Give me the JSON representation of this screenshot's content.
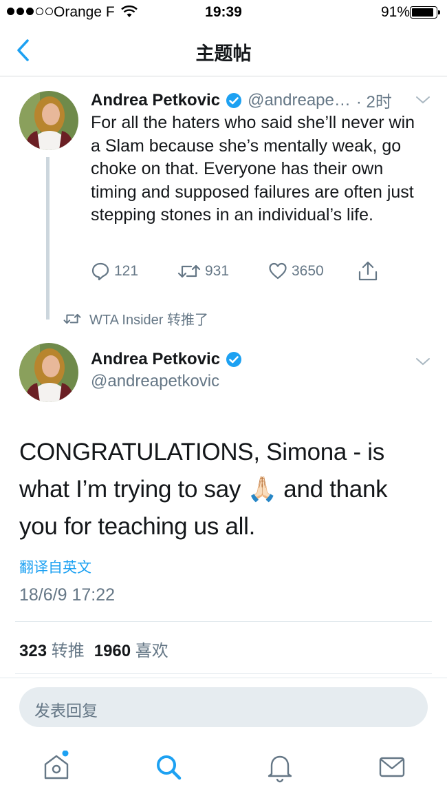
{
  "status_bar": {
    "carrier": "Orange F",
    "time": "19:39",
    "battery": "91%",
    "battery_level": 0.91
  },
  "nav": {
    "title": "主题帖",
    "back_icon": "chevron-left-icon"
  },
  "parent_tweet": {
    "name": "Andrea Petkovic",
    "handle": "@andreape…",
    "time": "· 2时",
    "text": "For all the haters who said she’ll never win a Slam because she’s mentally weak, go choke on that. Everyone has their own timing and supposed failures are often just stepping stones in an individual’s life.",
    "replies": "121",
    "retweets": "931",
    "likes": "3650"
  },
  "retweeted_by": "WTA Insider 转推了",
  "main_tweet": {
    "name": "Andrea Petkovic",
    "handle": "@andreapetkovic",
    "text_before_emoji": "CONGRATULATIONS, Simona - is what I’m trying to say",
    "emoji": "🙏🏻",
    "text_after_emoji": "and thank you for teaching us all.",
    "translate": "翻译自英文",
    "datetime": "18/6/9 17:22",
    "retweet_count": "323",
    "retweet_label": "转推",
    "like_count": "1960",
    "like_label": "喜欢"
  },
  "reply_box": {
    "placeholder": "发表回复"
  },
  "tab_bar": {
    "tabs": [
      "home-icon",
      "search-icon",
      "notifications-icon",
      "messages-icon"
    ],
    "active": "search-icon"
  },
  "colors": {
    "accent": "#1da1f2",
    "secondary_text": "#657786",
    "primary_text": "#14171a"
  }
}
